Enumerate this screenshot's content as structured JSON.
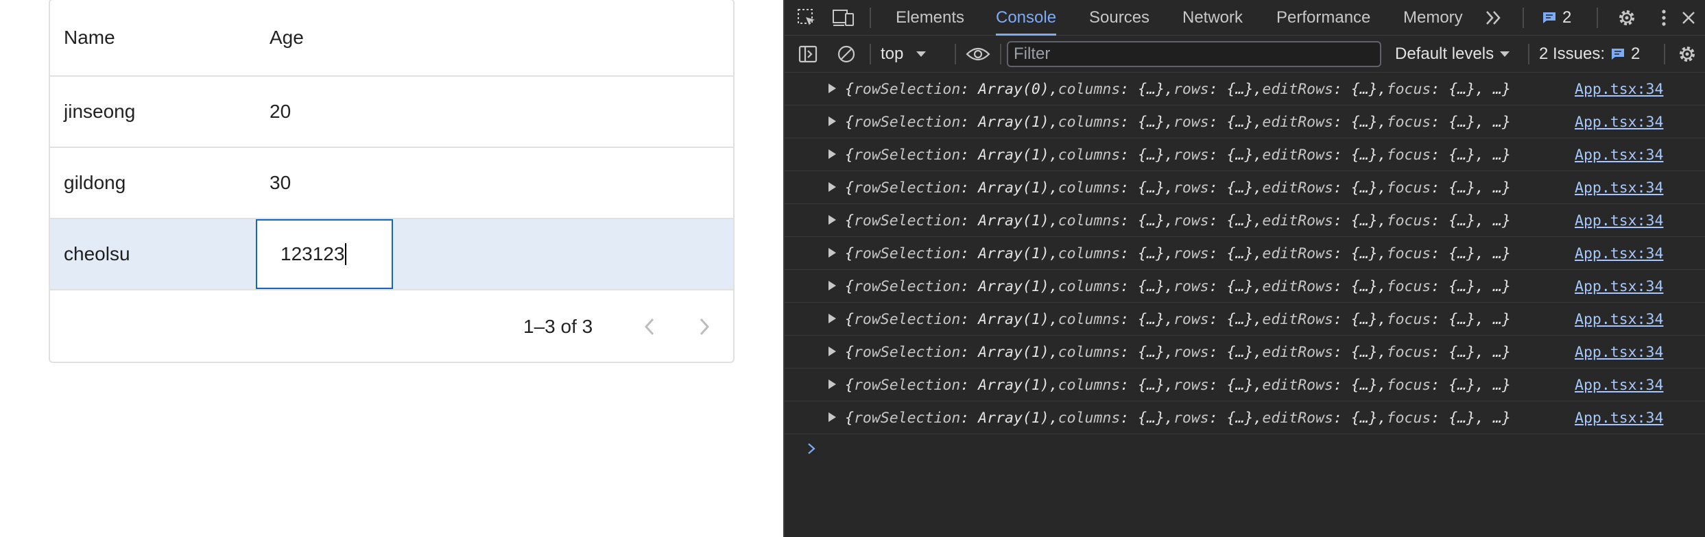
{
  "grid": {
    "columns": [
      "Name",
      "Age"
    ],
    "rows": [
      {
        "name": "jinseong",
        "age": "20"
      },
      {
        "name": "gildong",
        "age": "30"
      },
      {
        "name": "cheolsu",
        "age": "123123"
      }
    ],
    "selected_row_index": 2,
    "pagination": "1–3 of 3",
    "selected_row_color": "#e3ebf7",
    "edit_border_color": "#1565c0"
  },
  "devtools": {
    "tabs": [
      "Elements",
      "Console",
      "Sources",
      "Network",
      "Performance",
      "Memory"
    ],
    "active_tab": "Console",
    "messages_badge": "2",
    "toolbar": {
      "context": "top",
      "filter_placeholder": "Filter",
      "levels": "Default levels",
      "issues_label": "2 Issues:",
      "issues_count": "2"
    },
    "log_source": "App.tsx:34",
    "log_lines": [
      {
        "count": "0"
      },
      {
        "count": "1"
      },
      {
        "count": "1"
      },
      {
        "count": "1"
      },
      {
        "count": "1"
      },
      {
        "count": "1"
      },
      {
        "count": "1"
      },
      {
        "count": "1"
      },
      {
        "count": "1"
      },
      {
        "count": "1"
      },
      {
        "count": "1"
      }
    ],
    "accent_color": "#7cacf8",
    "icons": [
      "inspect-icon",
      "device-toolbar-icon",
      "more-tabs-icon",
      "message-icon",
      "settings-icon",
      "kebab-menu-icon",
      "close-icon",
      "sidebar-icon",
      "clear-console-icon",
      "eye-icon",
      "console-prompt-icon"
    ]
  }
}
